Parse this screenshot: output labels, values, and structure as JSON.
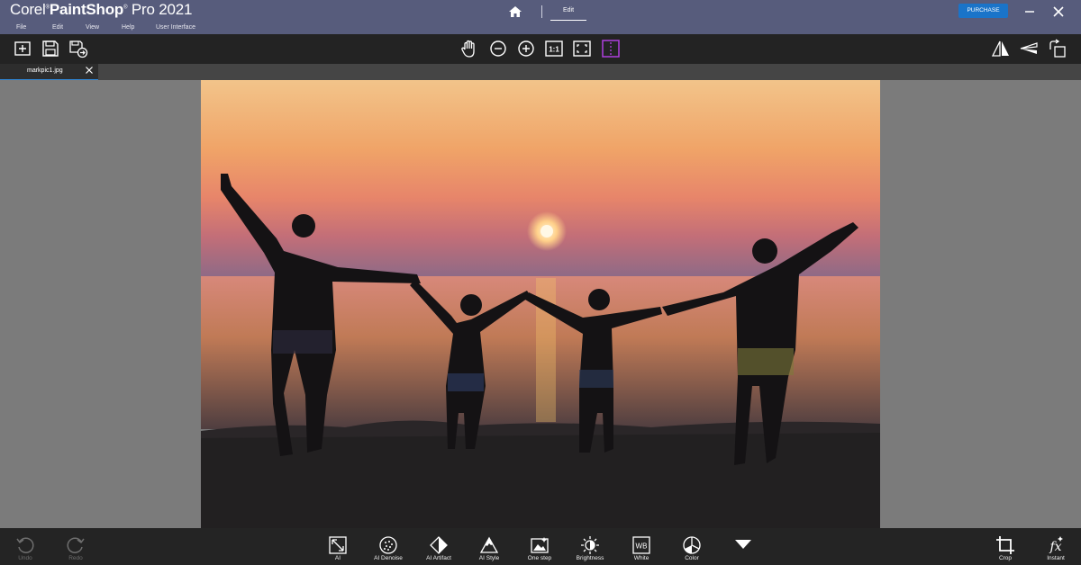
{
  "app": {
    "title_brand": "Corel",
    "title_product": "PaintShop",
    "title_suffix": "Pro 2021"
  },
  "menu": [
    "File",
    "Edit",
    "View",
    "Help",
    "User Interface"
  ],
  "nav": {
    "edit_tab": "Edit"
  },
  "header": {
    "purchase_label": "PURCHASE"
  },
  "document_tab": {
    "filename": "markpic1.jpg"
  },
  "bottom_tools": {
    "undo": "Undo",
    "redo": "Redo",
    "ai": "AI",
    "ai_denoise": "AI Denoise",
    "ai_artifact": "AI Artifact",
    "ai_style": "AI Style",
    "one_step": "One step",
    "brightness": "Brightness",
    "white": "White",
    "color": "Color",
    "crop": "Crop",
    "instant": "Instant"
  },
  "colors": {
    "title_bar": "#575c7c",
    "toolbar": "#232323",
    "accent": "#1a74c9",
    "tab_underline": "#2f86d6",
    "toggle_highlight": "#b040e0"
  },
  "icons": {
    "toolbar_left": [
      "new-file-icon",
      "save-icon",
      "save-as-icon"
    ],
    "toolbar_center": [
      "pan-hand-icon",
      "zoom-out-icon",
      "zoom-in-icon",
      "actual-size-icon",
      "fit-window-icon",
      "before-after-icon"
    ],
    "toolbar_right": [
      "flip-horizontal-icon",
      "straighten-icon",
      "rotate-icon"
    ]
  }
}
